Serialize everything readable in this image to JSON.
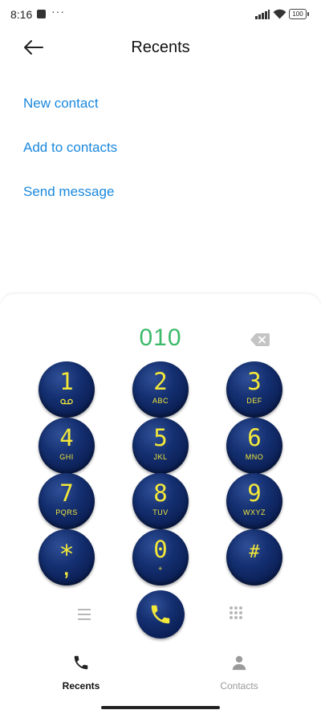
{
  "status_bar": {
    "time": "8:16",
    "dots": "···",
    "battery": "100"
  },
  "header": {
    "title": "Recents"
  },
  "actions": [
    {
      "label": "New contact"
    },
    {
      "label": "Add to contacts"
    },
    {
      "label": "Send message"
    }
  ],
  "dialer": {
    "number": "010",
    "keys": [
      {
        "digit": "1",
        "letters": ""
      },
      {
        "digit": "2",
        "letters": "ABC"
      },
      {
        "digit": "3",
        "letters": "DEF"
      },
      {
        "digit": "4",
        "letters": "GHI"
      },
      {
        "digit": "5",
        "letters": "JKL"
      },
      {
        "digit": "6",
        "letters": "MNO"
      },
      {
        "digit": "7",
        "letters": "PQRS"
      },
      {
        "digit": "8",
        "letters": "TUV"
      },
      {
        "digit": "9",
        "letters": "WXYZ"
      },
      {
        "digit": "*",
        "letters": ","
      },
      {
        "digit": "0",
        "letters": "+"
      },
      {
        "digit": "#",
        "letters": ""
      }
    ]
  },
  "bottom_nav": {
    "recents": "Recents",
    "contacts": "Contacts"
  },
  "colors": {
    "accent": "#1a88dd",
    "number": "#3cb96a",
    "key_face": "#0b1f55",
    "key_text": "#f4e83a"
  },
  "icons": {
    "back": "arrow-left-icon",
    "backspace": "backspace-icon",
    "voicemail": "voicemail-icon",
    "menu": "menu-icon",
    "dialpad": "dialpad-icon",
    "call": "phone-icon",
    "recents": "phone-icon",
    "contacts": "person-icon"
  }
}
